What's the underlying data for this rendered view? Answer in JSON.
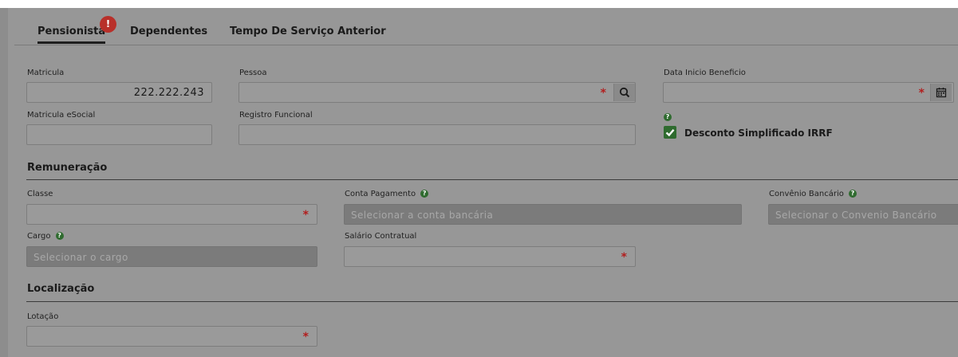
{
  "tabs": [
    {
      "label": "Pensionista",
      "badge": "!"
    },
    {
      "label": "Dependentes"
    },
    {
      "label": "Tempo De Serviço Anterior"
    }
  ],
  "fields": {
    "matricula": {
      "label": "Matricula",
      "value": "222.222.243"
    },
    "pessoa": {
      "label": "Pessoa",
      "required": "*"
    },
    "data_inicio": {
      "label": "Data Inicio Beneficio",
      "required": "*"
    },
    "matricula_esocial": {
      "label": "Matricula eSocial"
    },
    "registro_funcional": {
      "label": "Registro Funcional"
    },
    "desconto": {
      "label": "Desconto Simplificado IRRF",
      "help": "?"
    },
    "classe": {
      "label": "Classe",
      "required": "*"
    },
    "conta_pagamento": {
      "label": "Conta Pagamento",
      "help": "?",
      "placeholder": "Selecionar a conta bancária"
    },
    "convenio": {
      "label": "Convênio Bancário",
      "help": "?",
      "placeholder": "Selecionar o Convenio Bancário"
    },
    "cargo": {
      "label": "Cargo",
      "help": "?",
      "placeholder": "Selecionar o cargo"
    },
    "salario": {
      "label": "Salário Contratual",
      "required": "*"
    },
    "lotacao": {
      "label": "Lotação",
      "required": "*"
    }
  },
  "sections": {
    "remuneracao": "Remuneração",
    "localizacao": "Localização"
  },
  "icons": {
    "search": "search-icon",
    "calendar": "calendar-icon",
    "check": "check-icon",
    "help": "help-icon"
  },
  "colors": {
    "required": "#b21e1e",
    "help": "#2f6b2f",
    "badge": "#b8302a"
  }
}
